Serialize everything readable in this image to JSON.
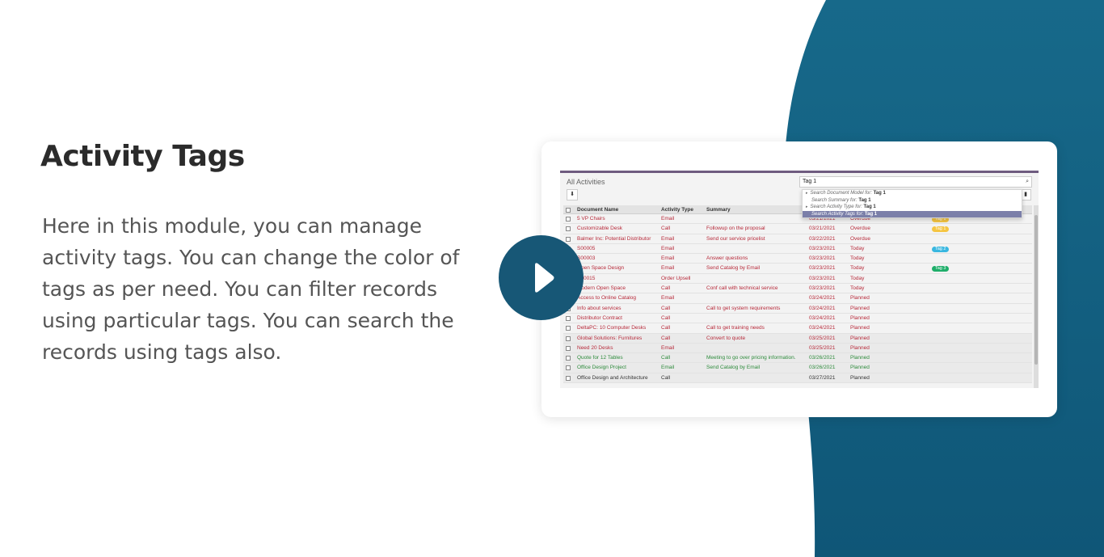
{
  "heading": "Activity Tags",
  "description": "Here in this module, you can manage activity tags. You can change the color of tags as per need. You can filter records using particular tags. You can search the records using tags also.",
  "colors": {
    "wave": "#125e7e",
    "play_button": "#175776",
    "tag_yellow": "#f5c542",
    "tag_blue": "#39b7e0",
    "tag_green": "#1fae6a"
  },
  "screenshot": {
    "title": "All Activities",
    "search_value": "Tag 1",
    "suggestions": [
      {
        "prefix": "Search Document Model for:",
        "term": "Tag 1"
      },
      {
        "prefix": "Search Summary for:",
        "term": "Tag 1"
      },
      {
        "prefix": "Search Activity Type for:",
        "term": "Tag 1"
      },
      {
        "prefix": "Search Activity Tags for:",
        "term": "Tag 1"
      }
    ],
    "columns": [
      "Document Name",
      "Activity Type",
      "Summary"
    ],
    "rows": [
      {
        "name": "5 VP Chairs",
        "type": "Email",
        "summary": "",
        "date": "03/21/2021",
        "status": "Overdue",
        "tag": "Tag 1",
        "color": "red"
      },
      {
        "name": "Customizable Desk",
        "type": "Call",
        "summary": "Followup on the proposal",
        "date": "03/21/2021",
        "status": "Overdue",
        "tag": "Tag 1",
        "color": "red"
      },
      {
        "name": "Balmer Inc: Potential Distributor",
        "type": "Email",
        "summary": "Send our service pricelist",
        "date": "03/22/2021",
        "status": "Overdue",
        "tag": "",
        "color": "red"
      },
      {
        "name": "S00005",
        "type": "Email",
        "summary": "",
        "date": "03/23/2021",
        "status": "Today",
        "tag": "Tag 2",
        "color": "red"
      },
      {
        "name": "S00003",
        "type": "Email",
        "summary": "Answer questions",
        "date": "03/23/2021",
        "status": "Today",
        "tag": "",
        "color": "red"
      },
      {
        "name": "Open Space Design",
        "type": "Email",
        "summary": "Send Catalog by Email",
        "date": "03/23/2021",
        "status": "Today",
        "tag": "Tag 3",
        "color": "red"
      },
      {
        "name": "S00015",
        "type": "Order Upsell",
        "summary": "",
        "date": "03/23/2021",
        "status": "Today",
        "tag": "",
        "color": "red"
      },
      {
        "name": "Modern Open Space",
        "type": "Call",
        "summary": "Conf call with technical service",
        "date": "03/23/2021",
        "status": "Today",
        "tag": "",
        "color": "red"
      },
      {
        "name": "Access to Online Catalog",
        "type": "Email",
        "summary": "",
        "date": "03/24/2021",
        "status": "Planned",
        "tag": "",
        "color": "red"
      },
      {
        "name": "Info about services",
        "type": "Call",
        "summary": "Call to get system requirements",
        "date": "03/24/2021",
        "status": "Planned",
        "tag": "",
        "color": "red"
      },
      {
        "name": "Distributor Contract",
        "type": "Call",
        "summary": "",
        "date": "03/24/2021",
        "status": "Planned",
        "tag": "",
        "color": "red"
      },
      {
        "name": "DeltaPC: 10 Computer Desks",
        "type": "Call",
        "summary": "Call to get training needs",
        "date": "03/24/2021",
        "status": "Planned",
        "tag": "",
        "color": "red"
      },
      {
        "name": "Global Solutions: Furnitures",
        "type": "Call",
        "summary": "Convert to quote",
        "date": "03/25/2021",
        "status": "Planned",
        "tag": "",
        "color": "red"
      },
      {
        "name": "Need 20 Desks",
        "type": "Email",
        "summary": "",
        "date": "03/25/2021",
        "status": "Planned",
        "tag": "",
        "color": "red"
      },
      {
        "name": "Quote for 12 Tables",
        "type": "Call",
        "summary": "Meeting to go over pricing information.",
        "date": "03/26/2021",
        "status": "Planned",
        "tag": "",
        "color": "green"
      },
      {
        "name": "Office Design Project",
        "type": "Email",
        "summary": "Send Catalog by Email",
        "date": "03/26/2021",
        "status": "Planned",
        "tag": "",
        "color": "green"
      },
      {
        "name": "Office Design and Architecture",
        "type": "Call",
        "summary": "",
        "date": "03/27/2021",
        "status": "Planned",
        "tag": "",
        "color": "dark"
      }
    ]
  }
}
